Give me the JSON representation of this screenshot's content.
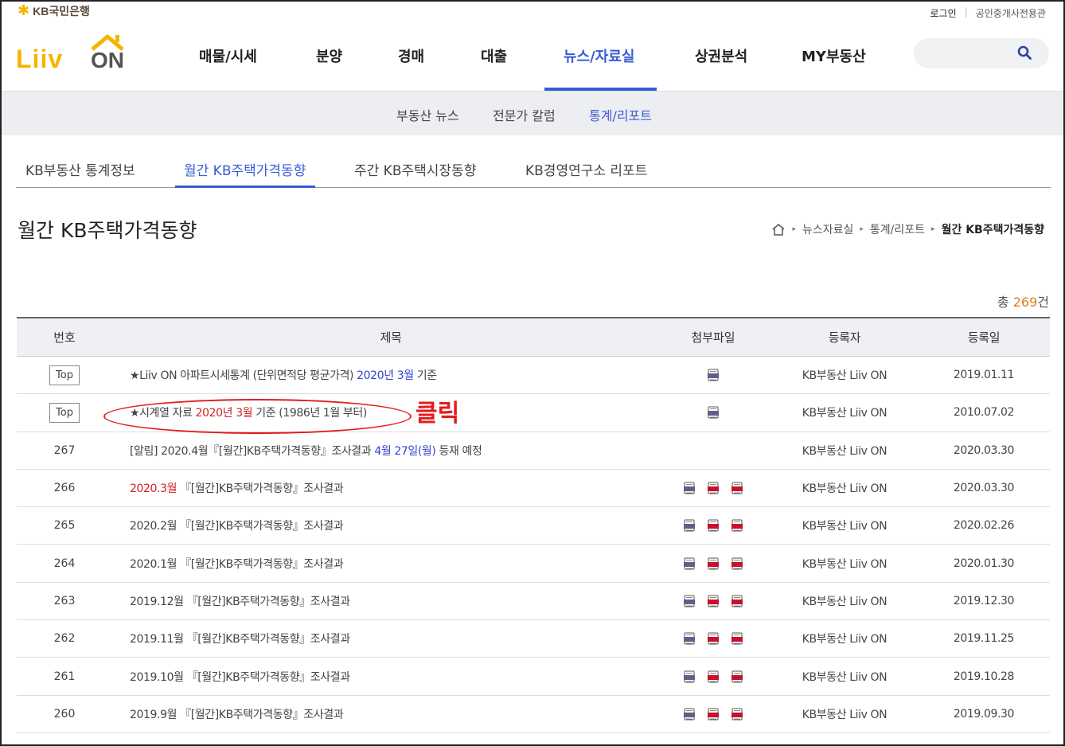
{
  "brand": {
    "kb_label": "KB국민은행",
    "logo_liiv": "Liiv",
    "logo_on": "ON"
  },
  "util": {
    "login": "로그인",
    "broker": "공인중개사전용관"
  },
  "gnb": [
    {
      "label": "매물/시세"
    },
    {
      "label": "분양"
    },
    {
      "label": "경매"
    },
    {
      "label": "대출"
    },
    {
      "label": "뉴스/자료실",
      "active": true
    },
    {
      "label": "상권분석"
    },
    {
      "label": "MY부동산"
    }
  ],
  "search": {
    "placeholder": "",
    "icon": "search-icon"
  },
  "subnav": [
    {
      "label": "부동산 뉴스"
    },
    {
      "label": "전문가 칼럼"
    },
    {
      "label": "통계/리포트",
      "active": true
    }
  ],
  "tabs": [
    {
      "label": "KB부동산 통계정보"
    },
    {
      "label": "월간 KB주택가격동향",
      "active": true
    },
    {
      "label": "주간 KB주택시장동향"
    },
    {
      "label": "KB경영연구소 리포트"
    }
  ],
  "page_title": "월간 KB주택가격동향",
  "breadcrumb": [
    "뉴스자료실",
    "통계/리포트",
    "월간 KB주택가격동향"
  ],
  "total": {
    "prefix": "총 ",
    "count": "269",
    "suffix": "건"
  },
  "table": {
    "headers": {
      "no": "번호",
      "title": "제목",
      "file": "첨부파일",
      "author": "등록자",
      "date": "등록일"
    },
    "rows": [
      {
        "no": "Top",
        "top": true,
        "parts": [
          [
            "★Liiv ON 아파트시세통계 (단위면적당 평균가격) ",
            ""
          ],
          [
            "2020년 3월",
            "blue"
          ],
          [
            " 기준",
            ""
          ]
        ],
        "files": [
          "hwp"
        ],
        "author": "KB부동산 Liiv ON",
        "date": "2019.01.11"
      },
      {
        "no": "Top",
        "top": true,
        "parts": [
          [
            "★시계열 자료 ",
            ""
          ],
          [
            "2020년 3월",
            "red"
          ],
          [
            " 기준 (1986년 1월 부터)",
            ""
          ]
        ],
        "files": [
          "hwp"
        ],
        "author": "KB부동산 Liiv ON",
        "date": "2010.07.02"
      },
      {
        "no": "267",
        "parts": [
          [
            "[알림] 2020.4월『[월간]KB주택가격동향』조사결과 ",
            ""
          ],
          [
            "4월 27일(월)",
            "blue"
          ],
          [
            " 등재 예정",
            ""
          ]
        ],
        "files": [],
        "author": "KB부동산 Liiv ON",
        "date": "2020.03.30"
      },
      {
        "no": "266",
        "parts": [
          [
            "2020.3월",
            "red"
          ],
          [
            " 『[월간]KB주택가격동향』조사결과",
            ""
          ]
        ],
        "files": [
          "hwp",
          "pdf",
          "pdf"
        ],
        "author": "KB부동산 Liiv ON",
        "date": "2020.03.30"
      },
      {
        "no": "265",
        "parts": [
          [
            "2020.2월 『[월간]KB주택가격동향』조사결과",
            ""
          ]
        ],
        "files": [
          "hwp",
          "pdf",
          "pdf"
        ],
        "author": "KB부동산 Liiv ON",
        "date": "2020.02.26"
      },
      {
        "no": "264",
        "parts": [
          [
            "2020.1월 『[월간]KB주택가격동향』조사결과",
            ""
          ]
        ],
        "files": [
          "hwp",
          "pdf",
          "pdf"
        ],
        "author": "KB부동산 Liiv ON",
        "date": "2020.01.30"
      },
      {
        "no": "263",
        "parts": [
          [
            "2019.12월 『[월간]KB주택가격동향』조사결과",
            ""
          ]
        ],
        "files": [
          "hwp",
          "pdf",
          "pdf"
        ],
        "author": "KB부동산 Liiv ON",
        "date": "2019.12.30"
      },
      {
        "no": "262",
        "parts": [
          [
            "2019.11월 『[월간]KB주택가격동향』조사결과",
            ""
          ]
        ],
        "files": [
          "hwp",
          "pdf",
          "pdf"
        ],
        "author": "KB부동산 Liiv ON",
        "date": "2019.11.25"
      },
      {
        "no": "261",
        "parts": [
          [
            "2019.10월 『[월간]KB주택가격동향』조사결과",
            ""
          ]
        ],
        "files": [
          "hwp",
          "pdf",
          "pdf"
        ],
        "author": "KB부동산 Liiv ON",
        "date": "2019.10.28"
      },
      {
        "no": "260",
        "parts": [
          [
            "2019.9월 『[월간]KB주택가격동향』조사결과",
            ""
          ]
        ],
        "files": [
          "hwp",
          "pdf",
          "pdf"
        ],
        "author": "KB부동산 Liiv ON",
        "date": "2019.09.30"
      }
    ]
  },
  "annotation": {
    "text": "클릭",
    "color": "#e41b1b"
  },
  "colors": {
    "accent": "#3b5bd6",
    "brand_yellow": "#f5b400",
    "count_orange": "#e07a1f"
  }
}
